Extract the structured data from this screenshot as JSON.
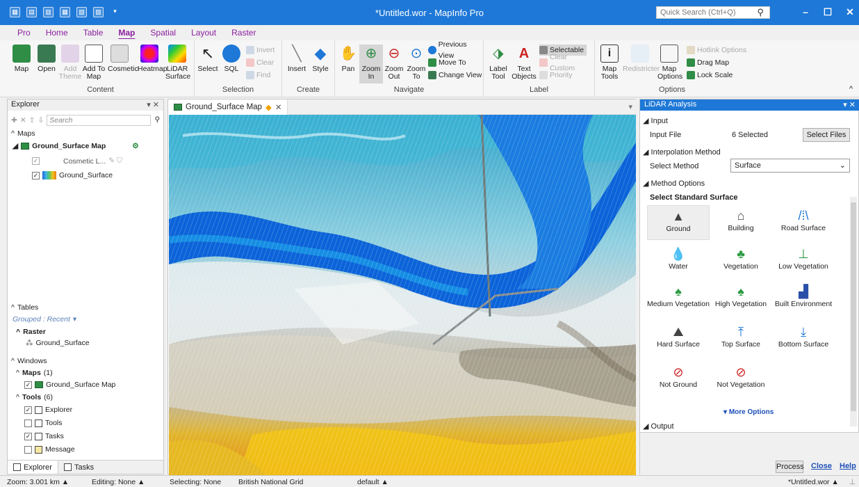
{
  "window": {
    "title": "*Untitled.wor - MapInfo Pro",
    "search_placeholder": "Quick Search (Ctrl+Q)"
  },
  "tabs": [
    "Pro",
    "Home",
    "Table",
    "Map",
    "Spatial",
    "Layout",
    "Raster"
  ],
  "ribbon": {
    "content": {
      "label": "Content",
      "map": "Map",
      "open": "Open",
      "add_theme": "Add Theme",
      "add_to_map": "Add To Map",
      "cosmetic": "Cosmetic",
      "heatmap": "Heatmap",
      "lidar_surface": "LiDAR Surface"
    },
    "selection": {
      "label": "Selection",
      "select": "Select",
      "sql": "SQL",
      "invert": "Invert",
      "clear": "Clear",
      "find": "Find"
    },
    "create": {
      "label": "Create",
      "insert": "Insert",
      "style": "Style"
    },
    "navigate": {
      "label": "Navigate",
      "pan": "Pan",
      "zoom_in": "Zoom In",
      "zoom_out": "Zoom Out",
      "zoom_to": "Zoom To",
      "previous_view": "Previous View",
      "move_to": "Move To",
      "change_view": "Change View"
    },
    "label": {
      "label": "Label",
      "label_tool": "Label Tool",
      "text_objects": "Text Objects",
      "selectable": "Selectable",
      "clear_custom": "Clear Custom",
      "priority": "Priority"
    },
    "options": {
      "label": "Options",
      "map_tools": "Map Tools",
      "redistricter": "Redistricter",
      "map_options": "Map Options",
      "hotlink_options": "Hotlink Options",
      "drag_map": "Drag Map",
      "lock_scale": "Lock Scale"
    }
  },
  "explorer": {
    "title": "Explorer",
    "search_placeholder": "Search",
    "maps_header": "Maps",
    "map_name": "Ground_Surface Map",
    "cosmetic_layer": "Cosmetic L...",
    "layer": "Ground_Surface",
    "tables_header": "Tables",
    "grouped": "Grouped : Recent",
    "raster_header": "Raster",
    "raster_item": "Ground_Surface",
    "windows_header": "Windows",
    "maps_sub": "Maps",
    "maps_count": "(1)",
    "window_map": "Ground_Surface Map",
    "tools_sub": "Tools",
    "tools_count": "(6)",
    "tools": [
      "Explorer",
      "Tools",
      "Tasks",
      "Message"
    ],
    "bottom_tabs": [
      "Explorer",
      "Tasks"
    ]
  },
  "map_window": {
    "tab": "Ground_Surface Map"
  },
  "lidar": {
    "title": "LiDAR Analysis",
    "input_header": "Input",
    "input_file_label": "Input File",
    "input_file_value": "6  Selected",
    "select_files": "Select Files",
    "interp_header": "Interpolation Method",
    "select_method_label": "Select Method",
    "select_method_value": "Surface",
    "method_header": "Method Options",
    "standard_surface": "Select Standard Surface",
    "surfaces": [
      "Ground",
      "Building",
      "Road Surface",
      "Water",
      "Vegetation",
      "Low Vegetation",
      "Medium Vegetation",
      "High Vegetation",
      "Built Environment",
      "Hard Surface",
      "Top Surface",
      "Bottom Surface",
      "Not Ground",
      "Not Vegetation"
    ],
    "more_options": "More Options",
    "output_header": "Output",
    "process": "Process",
    "close": "Close",
    "help": "Help"
  },
  "status": {
    "zoom": "Zoom: 3.001 km",
    "editing": "Editing: None",
    "selecting": "Selecting: None",
    "projection": "British National Grid",
    "style": "default",
    "workspace": "*Untitled.wor"
  },
  "colors": {
    "accent": "#1e78d7",
    "tab_text": "#8a1e9e"
  }
}
